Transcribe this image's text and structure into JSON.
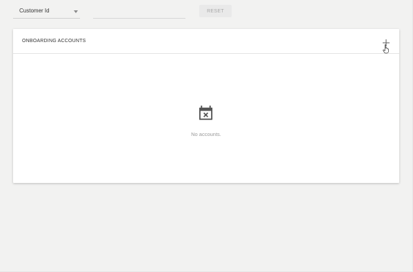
{
  "filters": {
    "select_label": "Customer Id",
    "search_value": "",
    "reset_label": "RESET"
  },
  "card": {
    "title": "ONBOARDING ACCOUNTS",
    "add_icon": "plus-icon",
    "empty_icon": "calendar-remove-icon",
    "empty_message": "No accounts."
  },
  "colors": {
    "background": "#f2f2f1",
    "card": "#ffffff",
    "muted_text": "#9a9a9a",
    "icon": "#555555"
  }
}
